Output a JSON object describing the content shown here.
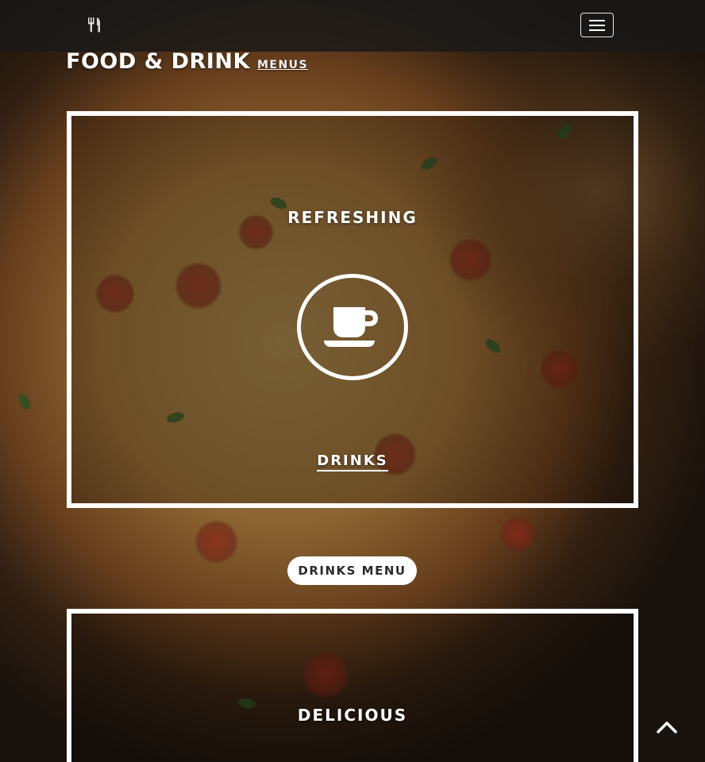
{
  "header": {
    "brand_icon": "utensils-icon",
    "menu_icon": "hamburger-menu-icon"
  },
  "page": {
    "title": "FOOD & DRINK",
    "subtitle": "MENUS"
  },
  "drinks_card": {
    "heading": "REFRESHING",
    "icon": "coffee-cup-icon",
    "link_label": "DRINKS"
  },
  "drinks_menu_button": {
    "label": "DRINKS MENU"
  },
  "food_card": {
    "heading": "DELICIOUS"
  },
  "back_to_top": {
    "icon": "chevron-up-icon"
  },
  "colors": {
    "card_border": "#ffffff",
    "topbar_bg": "#191919",
    "button_bg": "#ffffff",
    "button_text": "#2b2b2b"
  }
}
